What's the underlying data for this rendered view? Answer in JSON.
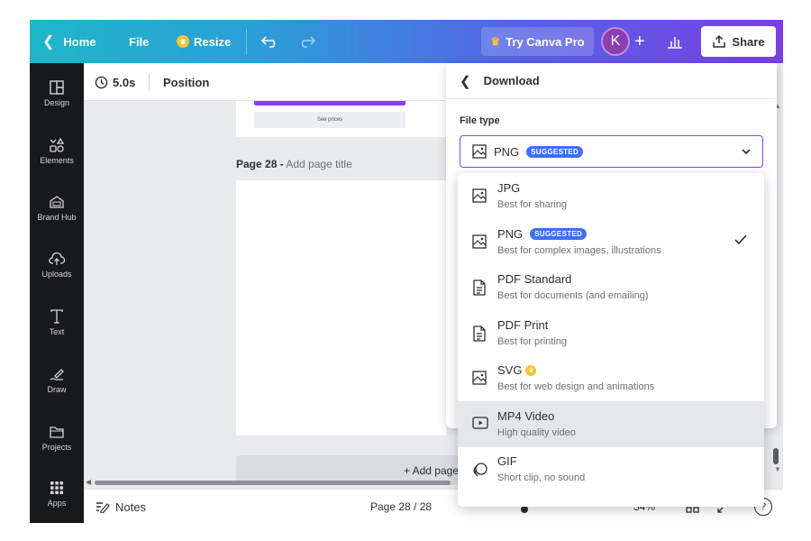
{
  "topbar": {
    "home_label": "Home",
    "file_label": "File",
    "resize_label": "Resize",
    "try_pro_label": "Try Canva Pro",
    "avatar_initial": "K",
    "share_label": "Share",
    "gradient_start": "#1fb6c9",
    "gradient_end": "#7b3fe4"
  },
  "sidebar": {
    "items": [
      {
        "label": "Design",
        "icon": "layout-icon"
      },
      {
        "label": "Elements",
        "icon": "shapes-icon"
      },
      {
        "label": "Brand Hub",
        "icon": "brand-hub-icon"
      },
      {
        "label": "Uploads",
        "icon": "cloud-upload-icon"
      },
      {
        "label": "Text",
        "icon": "text-icon"
      },
      {
        "label": "Draw",
        "icon": "draw-icon"
      },
      {
        "label": "Projects",
        "icon": "folder-icon"
      },
      {
        "label": "Apps",
        "icon": "apps-grid-icon"
      }
    ]
  },
  "context_bar": {
    "duration": "5.0s",
    "position_label": "Position"
  },
  "canvas": {
    "prev_page_button": "See prices",
    "page_number": "Page 28 -",
    "page_title_placeholder": "Add page title",
    "add_page_label": "+ Add page"
  },
  "bottom_bar": {
    "notes_label": "Notes",
    "page_indicator": "Page 28 / 28",
    "zoom_partial": "34%",
    "help_label": "?"
  },
  "download_panel": {
    "title": "Download",
    "file_type_label": "File type",
    "selected_type": "PNG",
    "selected_badge": "SUGGESTED",
    "accent_color": "#8b3dff",
    "badge_color": "#3d6ff5"
  },
  "file_type_options": [
    {
      "name": "JPG",
      "desc": "Best for sharing",
      "badge": "",
      "pro": false,
      "selected": false,
      "highlight": false,
      "icon": "image-icon"
    },
    {
      "name": "PNG",
      "desc": "Best for complex images, illustrations",
      "badge": "SUGGESTED",
      "pro": false,
      "selected": true,
      "highlight": false,
      "icon": "image-icon"
    },
    {
      "name": "PDF Standard",
      "desc": "Best for documents (and emailing)",
      "badge": "",
      "pro": false,
      "selected": false,
      "highlight": false,
      "icon": "document-icon"
    },
    {
      "name": "PDF Print",
      "desc": "Best for printing",
      "badge": "",
      "pro": false,
      "selected": false,
      "highlight": false,
      "icon": "document-icon"
    },
    {
      "name": "SVG",
      "desc": "Best for web design and animations",
      "badge": "",
      "pro": true,
      "selected": false,
      "highlight": false,
      "icon": "image-icon"
    },
    {
      "name": "MP4 Video",
      "desc": "High quality video",
      "badge": "",
      "pro": false,
      "selected": false,
      "highlight": true,
      "icon": "video-icon"
    },
    {
      "name": "GIF",
      "desc": "Short clip, no sound",
      "badge": "",
      "pro": false,
      "selected": false,
      "highlight": false,
      "icon": "gif-icon"
    }
  ]
}
